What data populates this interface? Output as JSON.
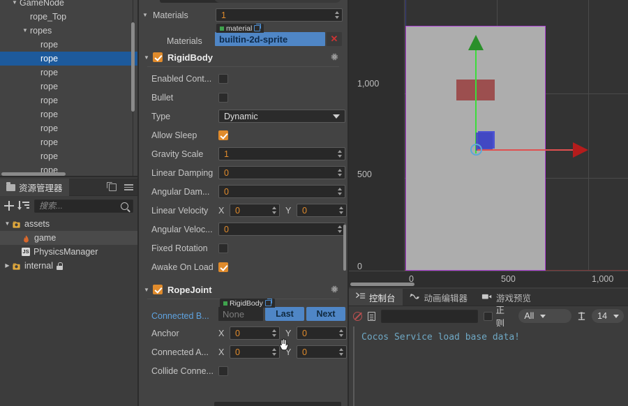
{
  "hierarchy": {
    "rows": [
      {
        "label": "GameNode",
        "indent": 1,
        "twisty": "▼",
        "selected": false
      },
      {
        "label": "rope_Top",
        "indent": 2,
        "twisty": "",
        "selected": false
      },
      {
        "label": "ropes",
        "indent": 2,
        "twisty": "▼",
        "selected": false
      },
      {
        "label": "rope",
        "indent": 3,
        "twisty": "",
        "selected": false
      },
      {
        "label": "rope",
        "indent": 3,
        "twisty": "",
        "selected": true
      },
      {
        "label": "rope",
        "indent": 3,
        "twisty": "",
        "selected": false
      },
      {
        "label": "rope",
        "indent": 3,
        "twisty": "",
        "selected": false
      },
      {
        "label": "rope",
        "indent": 3,
        "twisty": "",
        "selected": false
      },
      {
        "label": "rope",
        "indent": 3,
        "twisty": "",
        "selected": false
      },
      {
        "label": "rope",
        "indent": 3,
        "twisty": "",
        "selected": false
      },
      {
        "label": "rope",
        "indent": 3,
        "twisty": "",
        "selected": false
      },
      {
        "label": "rope",
        "indent": 3,
        "twisty": "",
        "selected": false
      },
      {
        "label": "rope",
        "indent": 3,
        "twisty": "",
        "selected": false
      }
    ]
  },
  "assets": {
    "tab_label": "资源管理器",
    "search_placeholder": "搜索...",
    "search_value": "",
    "tree": [
      {
        "label": "assets",
        "indent": 0,
        "twisty": "▼",
        "icon": "folder-asset-icon",
        "selected": false,
        "locked": false
      },
      {
        "label": "game",
        "indent": 1,
        "twisty": "",
        "icon": "flame-icon",
        "selected": true,
        "locked": false
      },
      {
        "label": "PhysicsManager",
        "indent": 1,
        "twisty": "",
        "icon": "js-file-icon",
        "selected": false,
        "locked": false
      },
      {
        "label": "internal",
        "indent": 0,
        "twisty": "▶",
        "icon": "folder-asset-icon",
        "selected": false,
        "locked": true
      }
    ]
  },
  "inspector": {
    "materials_section": {
      "label": "Materials",
      "count": "1",
      "item_label": "Materials",
      "asset_tag": "material",
      "asset_value": "builtin-2d-sprite",
      "clear_label": "✕"
    },
    "rigidbody": {
      "title": "RigidBody",
      "enabled": true,
      "props": [
        {
          "label": "Enabled Cont...",
          "type": "checkbox",
          "value": false
        },
        {
          "label": "Bullet",
          "type": "checkbox",
          "value": false
        },
        {
          "label": "Type",
          "type": "select",
          "value": "Dynamic"
        },
        {
          "label": "Allow Sleep",
          "type": "checkbox",
          "value": true
        },
        {
          "label": "Gravity Scale",
          "type": "number",
          "value": "1"
        },
        {
          "label": "Linear Damping",
          "type": "number",
          "value": "0"
        },
        {
          "label": "Angular Dam...",
          "type": "number",
          "value": "0"
        },
        {
          "label": "Linear Velocity",
          "type": "vec2",
          "x": "0",
          "y": "0"
        },
        {
          "label": "Angular Veloc...",
          "type": "number",
          "value": "0"
        },
        {
          "label": "Fixed Rotation",
          "type": "checkbox",
          "value": false
        },
        {
          "label": "Awake On Load",
          "type": "checkbox",
          "value": true
        }
      ]
    },
    "ropejoint": {
      "title": "RopeJoint",
      "enabled": true,
      "connected_body": {
        "label": "Connected B...",
        "tag": "RigidBody",
        "value": "None",
        "btn_last": "Last",
        "btn_next": "Next"
      },
      "props": [
        {
          "label": "Anchor",
          "type": "vec2",
          "x": "0",
          "y": "0"
        },
        {
          "label": "Connected A...",
          "type": "vec2",
          "x": "0",
          "y": "0"
        },
        {
          "label": "Collide Conne...",
          "type": "checkbox",
          "value": false
        }
      ]
    },
    "axis_x": "X",
    "axis_y": "Y"
  },
  "scene": {
    "ruler_v": [
      "1,000",
      "500",
      "0"
    ],
    "ruler_h": [
      "0",
      "500",
      "1,000"
    ],
    "colors": {
      "canvas_fill": "#adadad",
      "canvas_border": "#b040d8",
      "node_red": "#9c4f4f",
      "node_blue": "#4147c0",
      "gizmo_y": "#3cdd3c",
      "gizmo_x": "#e05050",
      "gizmo_pivot": "#5ca8d8"
    }
  },
  "console": {
    "tabs": [
      {
        "label": "控制台",
        "icon": "console-icon",
        "active": true
      },
      {
        "label": "动画编辑器",
        "icon": "animation-icon",
        "active": false
      },
      {
        "label": "游戏预览",
        "icon": "camera-icon",
        "active": false
      }
    ],
    "filter_value": "",
    "regex_label": "正则",
    "regex_checked": false,
    "level_filter": "All",
    "font_size": "14",
    "logs": [
      "Cocos Service load base data!"
    ]
  }
}
